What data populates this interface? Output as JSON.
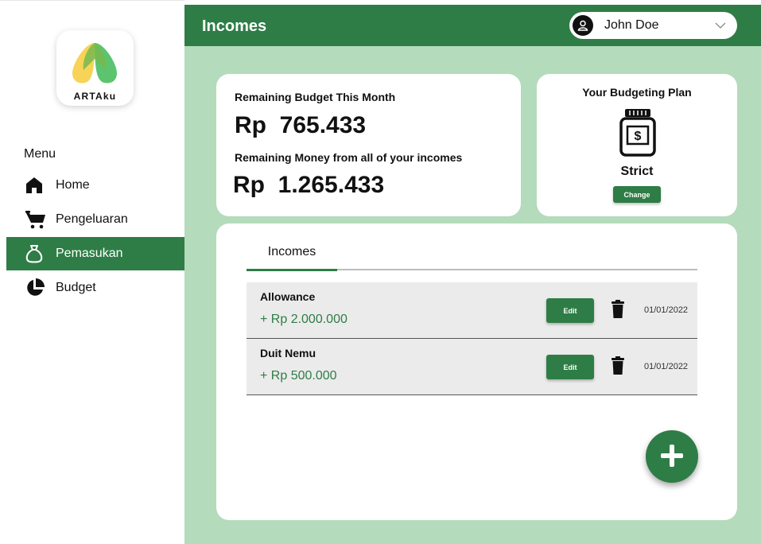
{
  "sidebar": {
    "logo_text": "ARTAku",
    "menu_title": "Menu",
    "items": [
      {
        "label": "Home",
        "icon": "home-icon"
      },
      {
        "label": "Pengeluaran",
        "icon": "cart-icon"
      },
      {
        "label": "Pemasukan",
        "icon": "money-bag-icon",
        "active": true
      },
      {
        "label": "Budget",
        "icon": "pie-chart-icon"
      }
    ]
  },
  "header": {
    "title": "Incomes",
    "user_name": "John Doe"
  },
  "summary": {
    "remaining_budget_label": "Remaining Budget This Month",
    "remaining_budget_value": "Rp  765.433",
    "remaining_money_label": "Remaining Money from all of your incomes",
    "remaining_money_value": "Rp  1.265.433"
  },
  "plan": {
    "title": "Your Budgeting Plan",
    "name": "Strict",
    "change_label": "Change",
    "icon": "money-jar-icon"
  },
  "incomes": {
    "tab_label": "Incomes",
    "rows": [
      {
        "name": "Allowance",
        "amount": "+ Rp 2.000.000",
        "edit_label": "Edit",
        "date": "01/01/2022"
      },
      {
        "name": "Duit Nemu",
        "amount": "+ Rp 500.000",
        "edit_label": "Edit",
        "date": "01/01/2022"
      }
    ]
  },
  "colors": {
    "primary": "#2e7d46",
    "background": "#b4dbbb",
    "logo_yellow": "#f7d358",
    "logo_green": "#5cc46e"
  }
}
